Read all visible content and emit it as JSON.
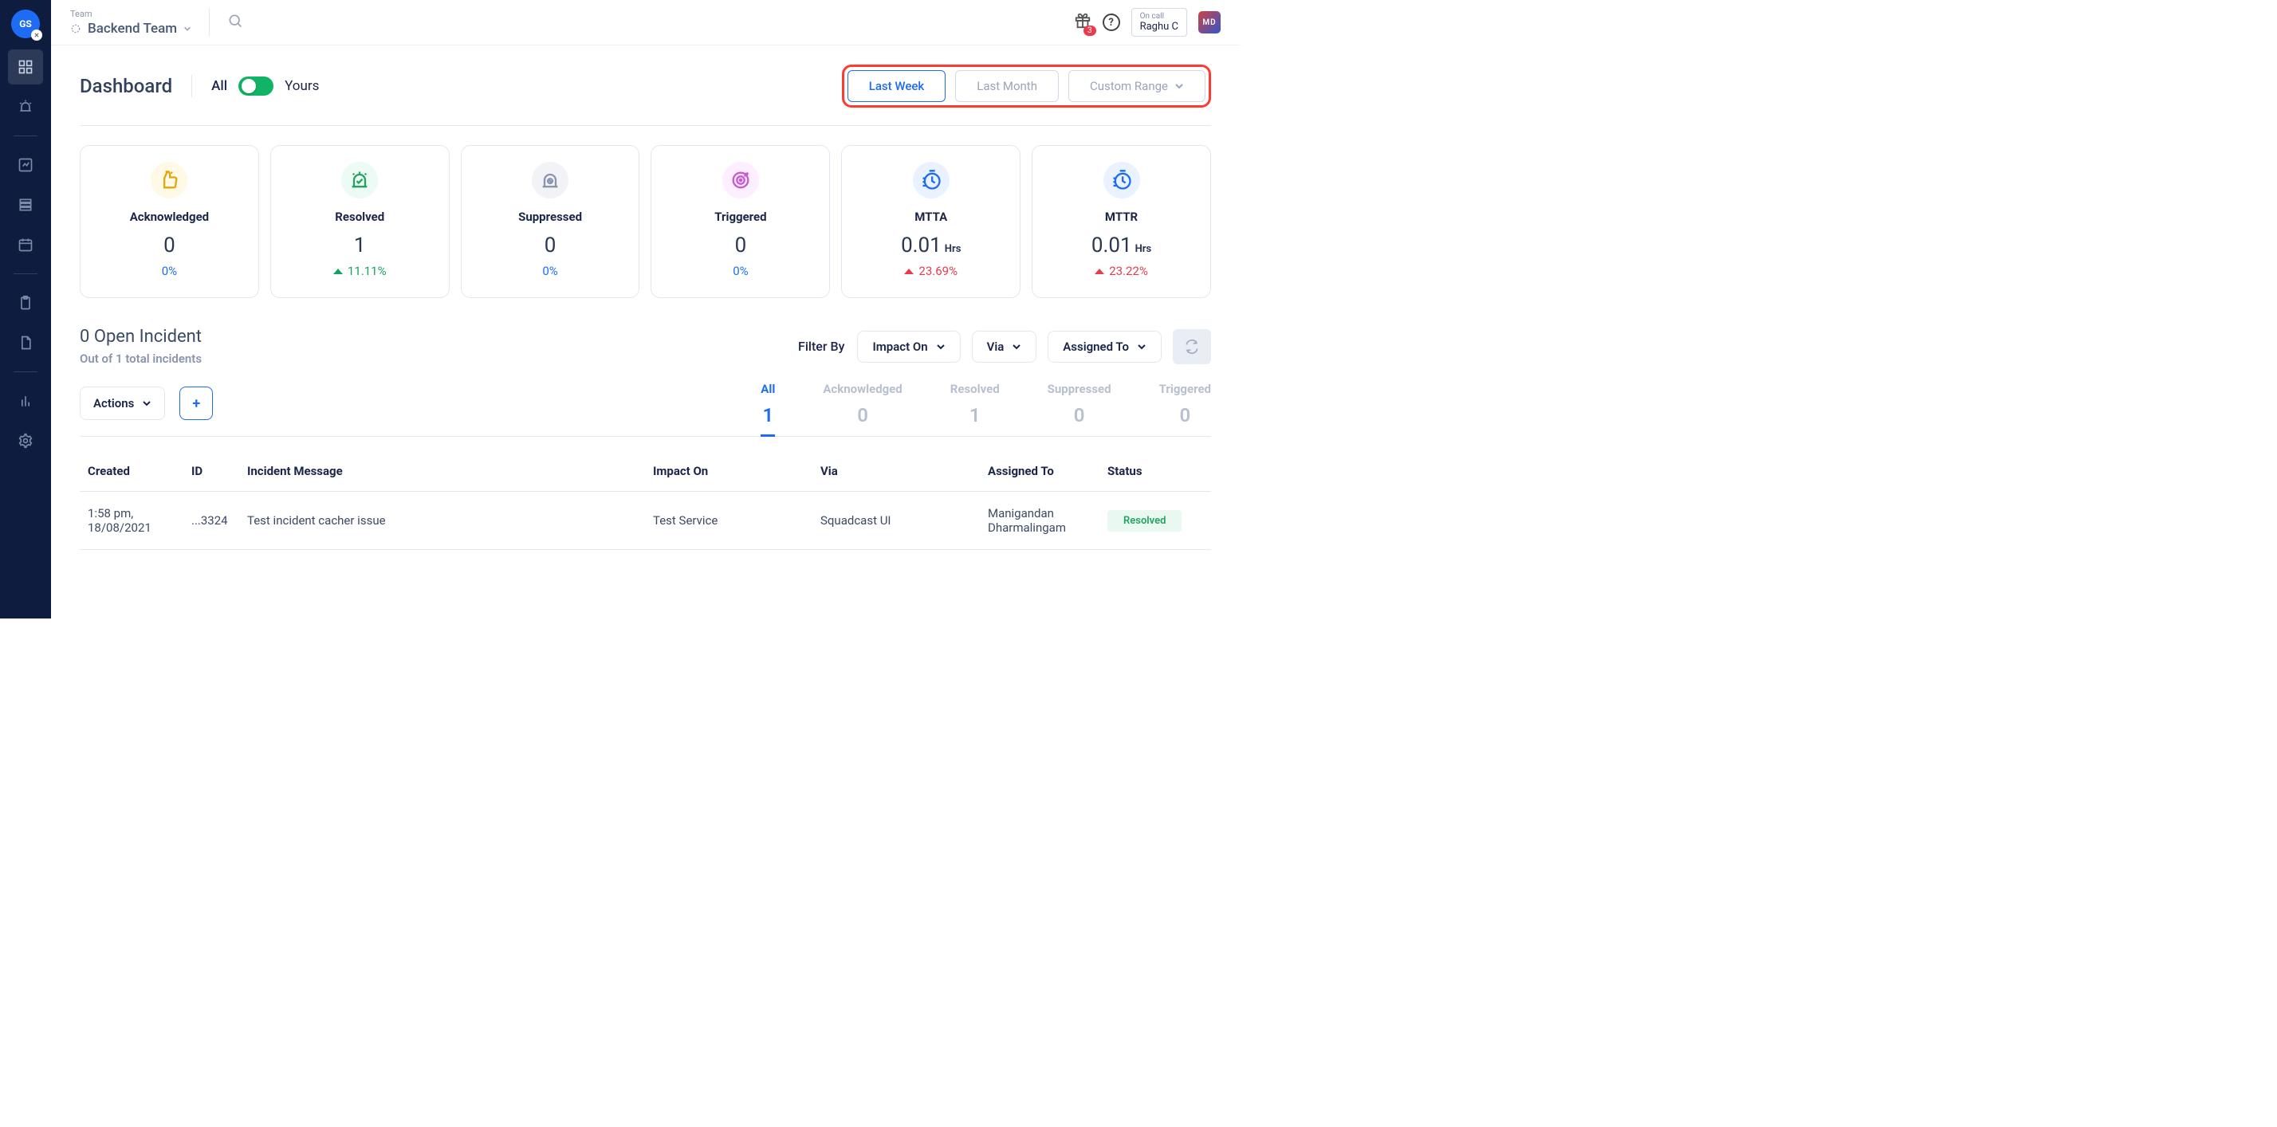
{
  "org_initials": "GS",
  "team_label": "Team",
  "team_name": "Backend Team",
  "notification_count": "3",
  "oncall_label": "On call",
  "oncall_name": "Raghu C",
  "user_initials": "MD",
  "page_title": "Dashboard",
  "scope": {
    "all": "All",
    "yours": "Yours"
  },
  "ranges": {
    "last_week": "Last Week",
    "last_month": "Last Month",
    "custom": "Custom Range"
  },
  "cards": {
    "ack": {
      "label": "Acknowledged",
      "value": "0",
      "delta": "0%"
    },
    "res": {
      "label": "Resolved",
      "value": "1",
      "delta": "11.11%"
    },
    "sup": {
      "label": "Suppressed",
      "value": "0",
      "delta": "0%"
    },
    "trig": {
      "label": "Triggered",
      "value": "0",
      "delta": "0%"
    },
    "mtta": {
      "label": "MTTA",
      "value": "0.01",
      "unit": "Hrs",
      "delta": "23.69%"
    },
    "mttr": {
      "label": "MTTR",
      "value": "0.01",
      "unit": "Hrs",
      "delta": "23.22%"
    }
  },
  "open_title": "0 Open Incident",
  "open_sub": "Out of 1 total incidents",
  "filter_label": "Filter By",
  "filters": {
    "impact": "Impact On",
    "via": "Via",
    "assigned": "Assigned To"
  },
  "actions_label": "Actions",
  "status_tabs": {
    "all": {
      "label": "All",
      "count": "1"
    },
    "ack": {
      "label": "Acknowledged",
      "count": "0"
    },
    "res": {
      "label": "Resolved",
      "count": "1"
    },
    "sup": {
      "label": "Suppressed",
      "count": "0"
    },
    "trig": {
      "label": "Triggered",
      "count": "0"
    }
  },
  "columns": {
    "created": "Created",
    "id": "ID",
    "msg": "Incident Message",
    "impact": "Impact On",
    "via": "Via",
    "assigned": "Assigned To",
    "status": "Status"
  },
  "row": {
    "created": "1:58 pm, 18/08/2021",
    "id": "...3324",
    "msg": "Test incident cacher issue",
    "impact": "Test Service",
    "via": "Squadcast UI",
    "assigned": "Manigandan Dharmalingam",
    "status": "Resolved"
  }
}
